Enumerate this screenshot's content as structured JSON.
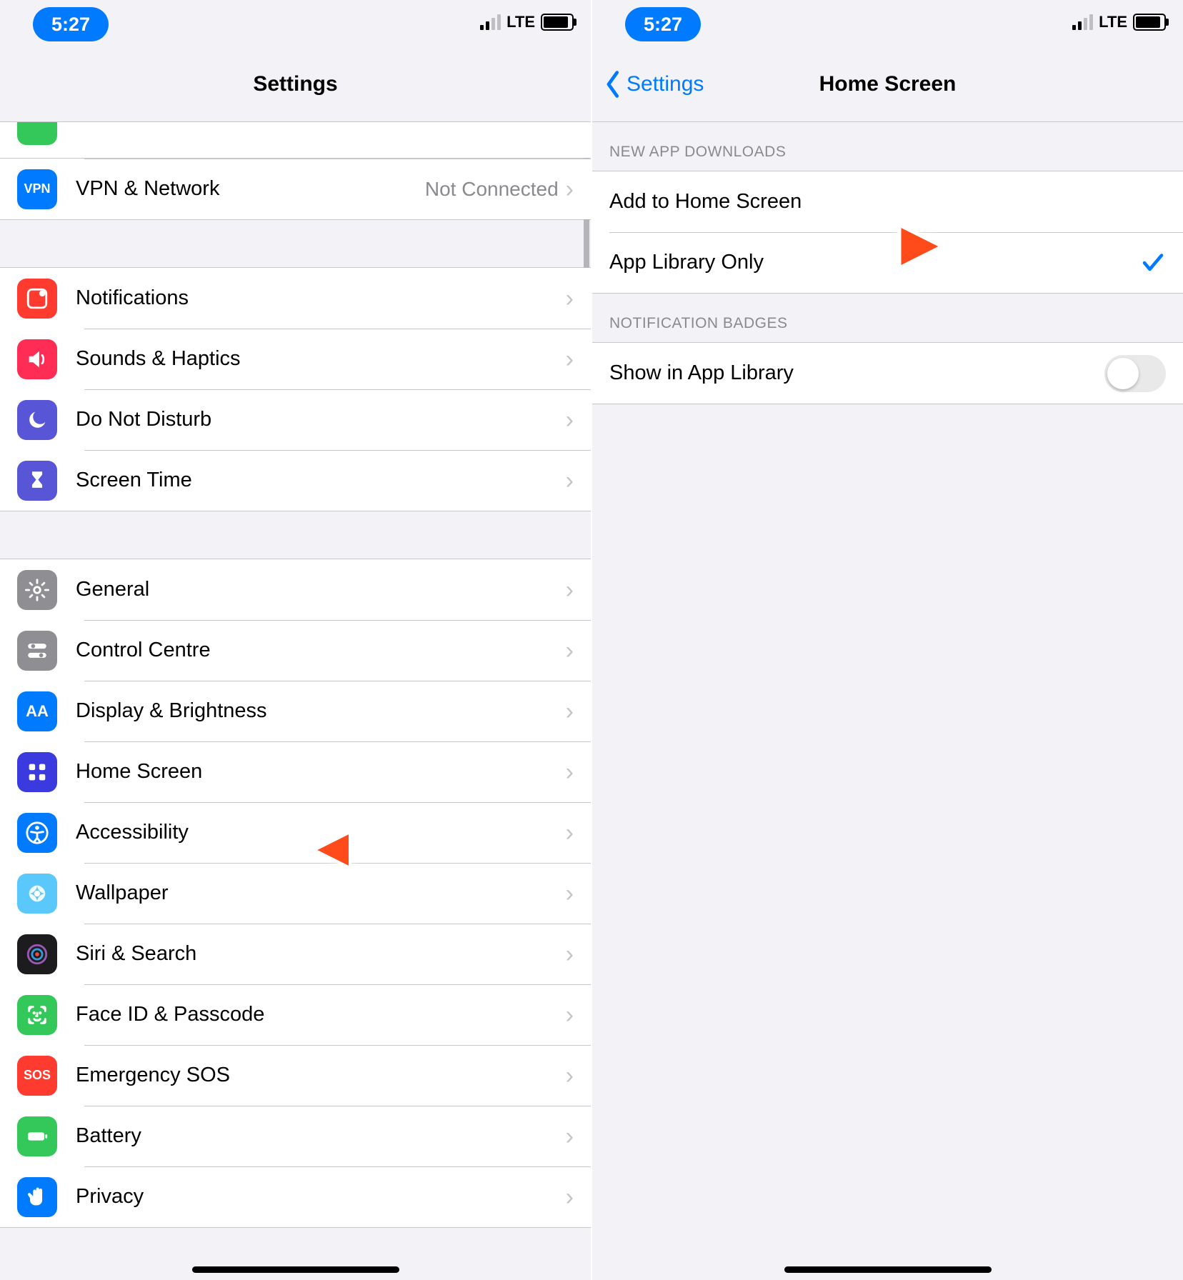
{
  "status": {
    "time": "5:27",
    "network": "LTE"
  },
  "left": {
    "title": "Settings",
    "rows": {
      "vpn": {
        "label": "VPN & Network",
        "detail": "Not Connected"
      },
      "notif": {
        "label": "Notifications"
      },
      "sounds": {
        "label": "Sounds & Haptics"
      },
      "dnd": {
        "label": "Do Not Disturb"
      },
      "screentime": {
        "label": "Screen Time"
      },
      "general": {
        "label": "General"
      },
      "control": {
        "label": "Control Centre"
      },
      "display": {
        "label": "Display & Brightness"
      },
      "home": {
        "label": "Home Screen"
      },
      "access": {
        "label": "Accessibility"
      },
      "wallpaper": {
        "label": "Wallpaper"
      },
      "siri": {
        "label": "Siri & Search"
      },
      "faceid": {
        "label": "Face ID & Passcode"
      },
      "sos": {
        "label": "Emergency SOS"
      },
      "battery": {
        "label": "Battery"
      },
      "privacy": {
        "label": "Privacy"
      }
    },
    "icons": {
      "vpn_text": "VPN",
      "aa_text": "AA",
      "sos_text": "SOS"
    }
  },
  "right": {
    "back": "Settings",
    "title": "Home Screen",
    "section1": "New App Downloads",
    "section2": "Notification Badges",
    "rows": {
      "add": {
        "label": "Add to Home Screen"
      },
      "lib": {
        "label": "App Library Only"
      },
      "show": {
        "label": "Show in App Library"
      }
    }
  }
}
